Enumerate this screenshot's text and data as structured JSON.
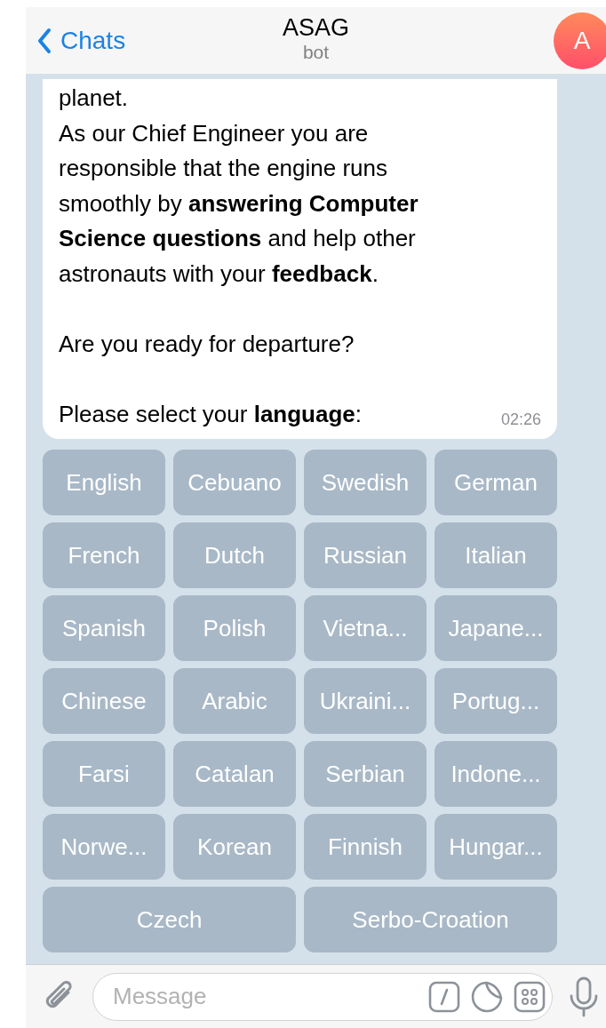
{
  "header": {
    "back_label": "Chats",
    "title": "ASAG",
    "subtitle": "bot",
    "avatar_letter": "A"
  },
  "message": {
    "blocks": [
      [
        "planet.",
        "As our Chief Engineer you are responsible that the engine runs smoothly by **answering Computer Science questions** and help other astronauts with your **feedback**."
      ],
      [
        "Are you ready for departure?"
      ],
      [
        "Please select your **language**:"
      ]
    ],
    "time": "02:26"
  },
  "keyboard": [
    [
      "English",
      "Cebuano",
      "Swedish",
      "German"
    ],
    [
      "French",
      "Dutch",
      "Russian",
      "Italian"
    ],
    [
      "Spanish",
      "Polish",
      "Vietna...",
      "Japane..."
    ],
    [
      "Chinese",
      "Arabic",
      "Ukraini...",
      "Portug..."
    ],
    [
      "Farsi",
      "Catalan",
      "Serbian",
      "Indone..."
    ],
    [
      "Norwe...",
      "Korean",
      "Finnish",
      "Hungar..."
    ],
    [
      "Czech",
      "Serbo-Croation"
    ]
  ],
  "input": {
    "placeholder": "Message"
  }
}
